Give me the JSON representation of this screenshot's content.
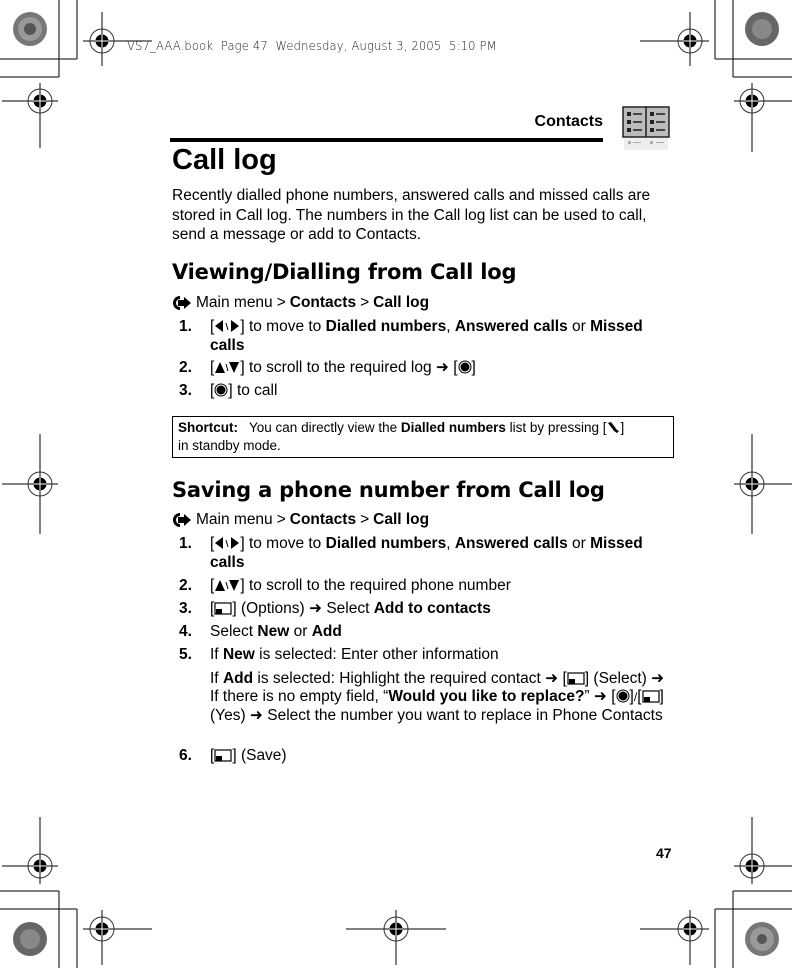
{
  "print_slug": "VS7_AAA.book  Page 47  Wednesday, August 3, 2005  5:10 PM",
  "running_head": "Contacts",
  "page_number": "47",
  "title": "Call log",
  "intro": "Recently dialled phone numbers, answered calls and missed calls are stored in Call log. The numbers in the Call log list can be used to call, send a message or add to Contacts.",
  "sections": [
    {
      "heading": "Viewing/Dialling from Call log",
      "path": {
        "prefix": "Main menu",
        "sep": ">",
        "item1": "Contacts",
        "item2": "Call log"
      },
      "steps": [
        {
          "num": "1.",
          "keys": "left/right-key",
          "pre": "to move to",
          "b1": "Dialled numbers",
          "comma": ",",
          "b2": "Answered calls",
          "or": "or",
          "b3": "Missed calls"
        },
        {
          "num": "2.",
          "keys": "up/down-key",
          "text": "to scroll to the required log",
          "after_key": "center-key"
        },
        {
          "num": "3.",
          "keys": "center-key",
          "text": "to call"
        }
      ]
    },
    {
      "heading": "Saving a phone number from Call log",
      "path": {
        "prefix": "Main menu",
        "sep": ">",
        "item1": "Contacts",
        "item2": "Call log"
      },
      "steps": [
        {
          "num": "1.",
          "keys": "left/right-key",
          "pre": "to move to",
          "b1": "Dialled numbers",
          "comma": ",",
          "b2": "Answered calls",
          "or": "or",
          "b3": "Missed calls"
        },
        {
          "num": "2.",
          "keys": "up/down-key",
          "text": "to scroll to the required phone number"
        },
        {
          "num": "3.",
          "keys": "softkey",
          "text": "(Options)",
          "select": "Select",
          "bold": "Add to contacts"
        },
        {
          "num": "4.",
          "pre": "Select",
          "b1": "New",
          "or": "or",
          "b2": "Add"
        },
        {
          "num": "5.",
          "line1_pre": "If",
          "line1_bold": "New",
          "line1_post": "is selected: Enter other information",
          "line2_pre": "If",
          "line2_bold": "Add",
          "line2_post": "is selected: Highlight the required contact",
          "select_label": "(Select)",
          "no_empty": "If there is no empty field, “",
          "question": "Would you like to replace?",
          "close_quote": "”",
          "yes_label": "(Yes)",
          "final": "Select the number you want to replace in Phone Contacts"
        },
        {
          "num": "6.",
          "keys": "softkey",
          "text": "(Save)"
        }
      ]
    }
  ],
  "shortcut": {
    "label": "Shortcut:",
    "pre": "You can directly view the",
    "bold": "Dialled numbers",
    "post": "list by pressing [",
    "key": "send-key",
    "end": "]",
    "line2": "in standby mode."
  },
  "icons": {
    "path_marker": "right-arrow-circle-icon",
    "chapter_tab": "contacts-book-icon"
  }
}
